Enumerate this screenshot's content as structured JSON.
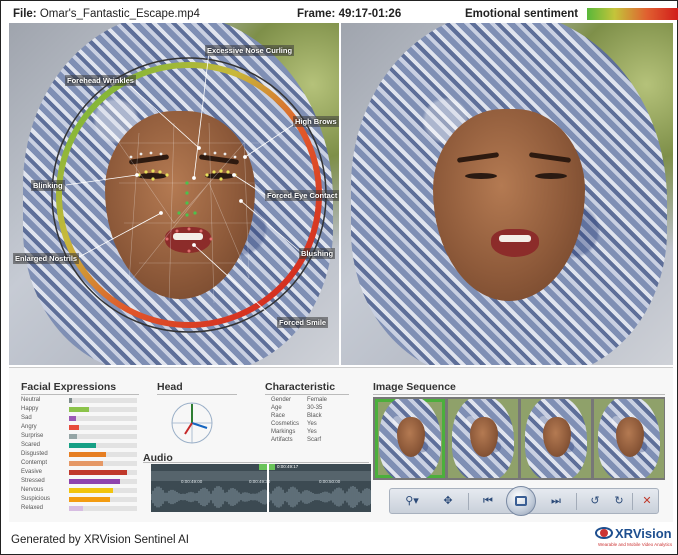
{
  "header": {
    "file_label": "File:",
    "file_name": "Omar's_Fantastic_Escape.mp4",
    "frame_label": "Frame:",
    "frame_value": "49:17-01:26",
    "sentiment_label": "Emotional sentiment",
    "sentiment_gradient": [
      "#58b83a",
      "#c4c43a",
      "#e06030",
      "#d11a1a"
    ]
  },
  "overlay_labels": {
    "excessive_nose_curling": "Excessive Nose Curling",
    "forehead_wrinkles": "Forehead Wrinkles",
    "high_brows": "High Brows",
    "blinking": "Blinking",
    "forced_eye_contact": "Forced Eye Contact",
    "blushing": "Blushing",
    "enlarged_nostrils": "Enlarged Nostrils",
    "forced_smile": "Forced Smile"
  },
  "facial_expressions": {
    "title": "Facial Expressions",
    "items": [
      {
        "label": "Neutral",
        "value": 0.05,
        "color": "#7f8c8d"
      },
      {
        "label": "Happy",
        "value": 0.3,
        "color": "#8bc34a"
      },
      {
        "label": "Sad",
        "value": 0.1,
        "color": "#9b59b6"
      },
      {
        "label": "Angry",
        "value": 0.15,
        "color": "#e74c3c"
      },
      {
        "label": "Surprise",
        "value": 0.12,
        "color": "#95a5a6"
      },
      {
        "label": "Scared",
        "value": 0.4,
        "color": "#16a085"
      },
      {
        "label": "Disgusted",
        "value": 0.55,
        "color": "#e67e22"
      },
      {
        "label": "Contempt",
        "value": 0.5,
        "color": "#e59866"
      },
      {
        "label": "Evasive",
        "value": 0.85,
        "color": "#c0392b"
      },
      {
        "label": "Stressed",
        "value": 0.75,
        "color": "#8e44ad"
      },
      {
        "label": "Nervous",
        "value": 0.65,
        "color": "#f1c40f"
      },
      {
        "label": "Suspicious",
        "value": 0.6,
        "color": "#f39c12"
      },
      {
        "label": "Relaxed",
        "value": 0.2,
        "color": "#d7bde2"
      }
    ]
  },
  "head": {
    "title": "Head"
  },
  "characteristic": {
    "title": "Characteristic",
    "rows": [
      {
        "key": "Gender",
        "value": "Female"
      },
      {
        "key": "Age",
        "value": "30-35"
      },
      {
        "key": "Race",
        "value": "Black"
      },
      {
        "key": "Cosmetics",
        "value": "Yes"
      },
      {
        "key": "Markings",
        "value": "Yes"
      },
      {
        "key": "Artifacts",
        "value": "Scarf"
      }
    ]
  },
  "audio": {
    "title": "Audio",
    "current_time": "0:00:49:17",
    "time_labels": [
      "0:00:49:00",
      "0:00:49:30",
      "0:00:50:00"
    ]
  },
  "image_sequence": {
    "title": "Image Sequence",
    "count": 4,
    "selected_index": 0
  },
  "controls": {
    "zoom": "zoom-icon",
    "move": "move-icon",
    "prev": "previous-icon",
    "play": "screen-icon",
    "next": "next-icon",
    "rotate_left": "rotate-left-icon",
    "rotate_right": "rotate-right-icon",
    "close": "close-icon"
  },
  "footer": {
    "generated": "Generated by XRVision Sentinel AI",
    "logo_word": "XRVision",
    "logo_tagline": "Wearable and Mobile Video Analytics"
  }
}
